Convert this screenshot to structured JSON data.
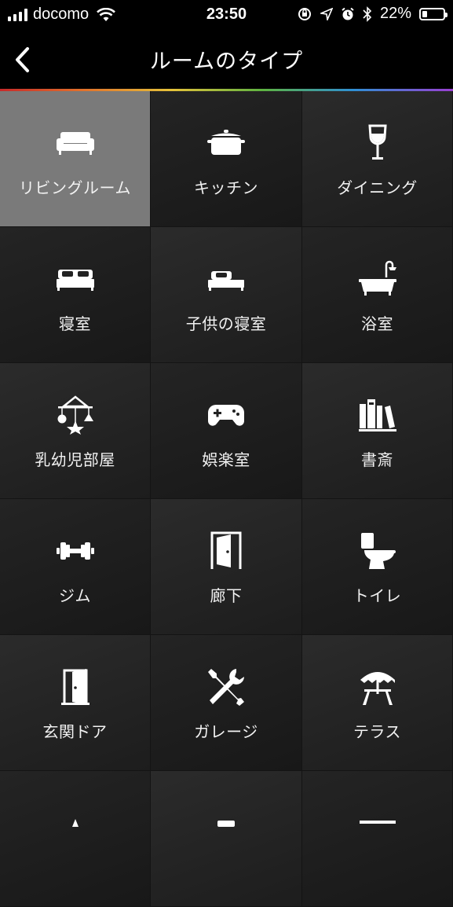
{
  "status_bar": {
    "carrier": "docomo",
    "time": "23:50",
    "battery_percent": "22%",
    "battery_level": 0.22
  },
  "nav": {
    "back_icon": "chevron-left-icon",
    "title": "ルームのタイプ"
  },
  "rooms": [
    {
      "label": "リビングルーム",
      "icon": "sofa-icon",
      "selected": true
    },
    {
      "label": "キッチン",
      "icon": "cooking-pot-icon"
    },
    {
      "label": "ダイニング",
      "icon": "wine-glass-icon"
    },
    {
      "label": "寝室",
      "icon": "bed-icon"
    },
    {
      "label": "子供の寝室",
      "icon": "single-bed-icon"
    },
    {
      "label": "浴室",
      "icon": "bathtub-icon"
    },
    {
      "label": "乳幼児部屋",
      "icon": "baby-mobile-icon"
    },
    {
      "label": "娯楽室",
      "icon": "gamepad-icon"
    },
    {
      "label": "書斎",
      "icon": "books-icon"
    },
    {
      "label": "ジム",
      "icon": "dumbbell-icon"
    },
    {
      "label": "廊下",
      "icon": "door-frame-icon"
    },
    {
      "label": "トイレ",
      "icon": "toilet-icon"
    },
    {
      "label": "玄関ドア",
      "icon": "front-door-icon"
    },
    {
      "label": "ガレージ",
      "icon": "tools-icon"
    },
    {
      "label": "テラス",
      "icon": "patio-umbrella-icon"
    }
  ]
}
